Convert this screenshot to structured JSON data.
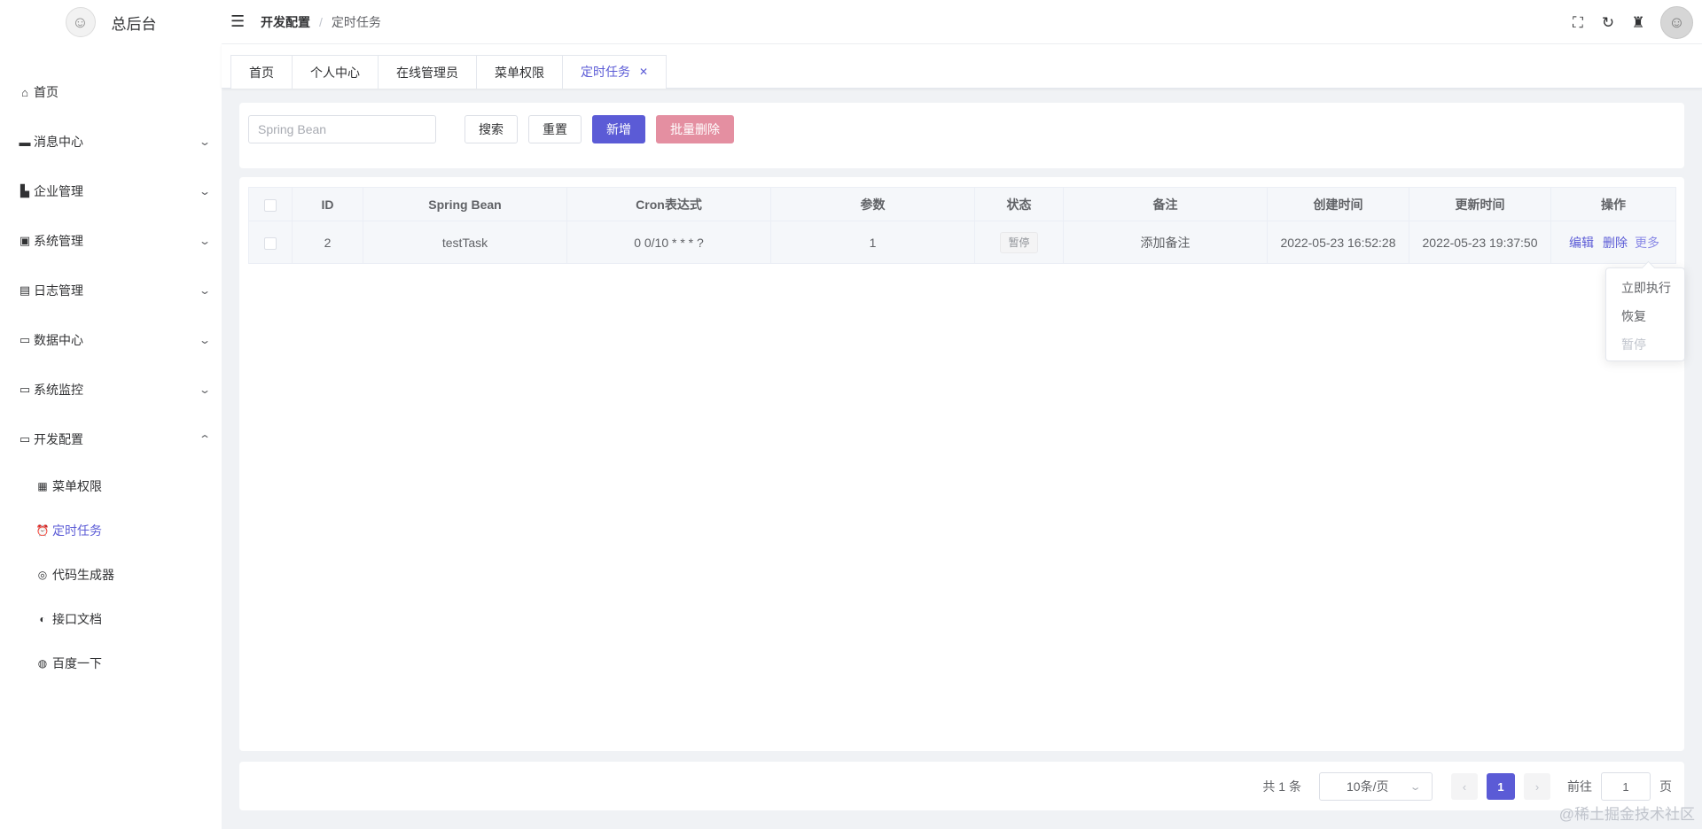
{
  "sidebar": {
    "logo_text": "总后台",
    "items": [
      {
        "label": "首页",
        "icon": "home-icon"
      },
      {
        "label": "消息中心",
        "icon": "message-icon"
      },
      {
        "label": "企业管理",
        "icon": "enterprise-icon"
      },
      {
        "label": "系统管理",
        "icon": "system-icon"
      },
      {
        "label": "日志管理",
        "icon": "log-icon"
      },
      {
        "label": "数据中心",
        "icon": "data-icon"
      },
      {
        "label": "系统监控",
        "icon": "monitor-icon"
      },
      {
        "label": "开发配置",
        "icon": "dev-icon"
      }
    ],
    "sub_items": [
      {
        "label": "菜单权限",
        "icon": "grid-icon"
      },
      {
        "label": "定时任务",
        "icon": "alarm-clock-icon"
      },
      {
        "label": "代码生成器",
        "icon": "code-icon"
      },
      {
        "label": "接口文档",
        "icon": "api-doc-icon"
      },
      {
        "label": "百度一下",
        "icon": "globe-icon"
      }
    ]
  },
  "header": {
    "breadcrumb_parent": "开发配置",
    "breadcrumb_current": "定时任务"
  },
  "tabs": [
    "首页",
    "个人中心",
    "在线管理员",
    "菜单权限",
    "定时任务"
  ],
  "search": {
    "placeholder": "Spring Bean",
    "search_label": "搜索",
    "reset_label": "重置",
    "add_label": "新增",
    "batch_delete_label": "批量删除"
  },
  "table": {
    "columns": [
      "ID",
      "Spring Bean",
      "Cron表达式",
      "参数",
      "状态",
      "备注",
      "创建时间",
      "更新时间",
      "操作"
    ],
    "rows": [
      {
        "id": "2",
        "bean": "testTask",
        "cron": "0 0/10 * * * ?",
        "params": "1",
        "status": "暂停",
        "remark": "添加备注",
        "created": "2022-05-23 16:52:28",
        "updated": "2022-05-23 19:37:50",
        "edit": "编辑",
        "delete": "删除",
        "more": "更多"
      }
    ]
  },
  "dropdown": [
    "立即执行",
    "恢复",
    "暂停"
  ],
  "pagination": {
    "total": "共 1 条",
    "page_size": "10条/页",
    "current_page": "1",
    "goto_label": "前往",
    "goto_value": "1",
    "page_suffix": "页"
  },
  "watermark": "@稀土掘金技术社区",
  "colors": {
    "primary": "#5b5bd6",
    "danger": "#e48fa1"
  }
}
